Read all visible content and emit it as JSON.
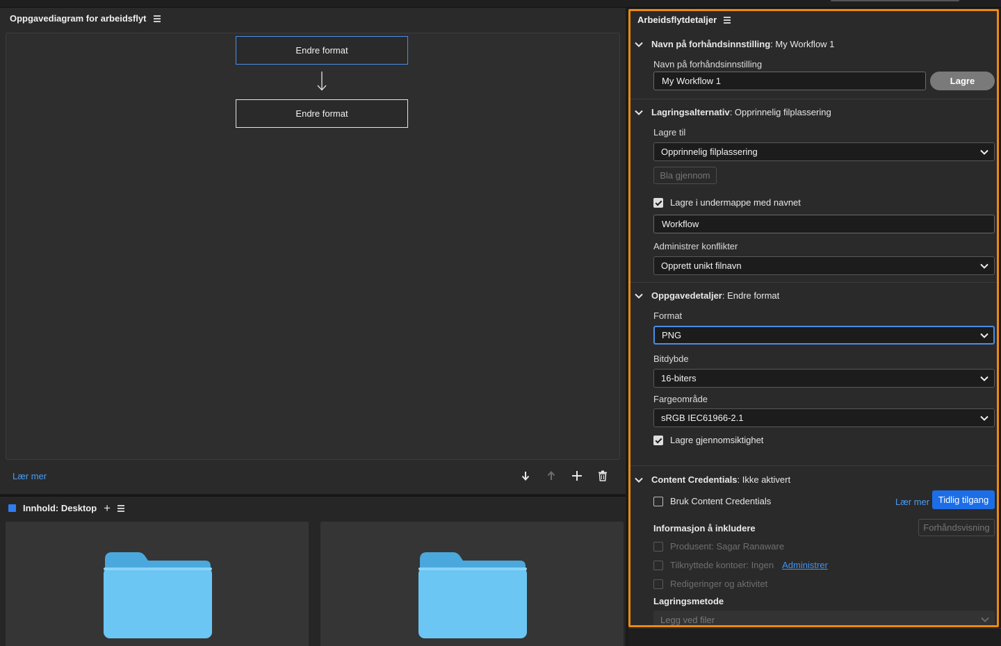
{
  "workflow_diagram": {
    "title": "Oppgavediagram for arbeidsflyt",
    "steps": [
      "Endre format",
      "Endre format"
    ],
    "learn_more": "Lær mer",
    "tools": [
      "move-down",
      "move-up",
      "add",
      "delete"
    ]
  },
  "content": {
    "title": "Innhold: Desktop",
    "tiles": [
      "folder",
      "folder"
    ]
  },
  "details": {
    "title": "Arbeidsflytdetaljer",
    "preset_section": {
      "title": "Navn på forhåndsinnstilling",
      "title_value": ": My Workflow 1",
      "label": "Navn på forhåndsinnstilling",
      "value": "My Workflow 1",
      "save_button": "Lagre"
    },
    "save_section": {
      "title": "Lagringsalternativ",
      "title_value": ": Opprinnelig filplassering",
      "save_to_label": "Lagre til",
      "save_to_value": "Opprinnelig filplassering",
      "browse_button": "Bla gjennom",
      "subfolder_checkbox": "Lagre i undermappe med navnet",
      "subfolder_checked": true,
      "subfolder_value": "Workflow",
      "conflicts_label": "Administrer konflikter",
      "conflicts_value": "Opprett unikt filnavn"
    },
    "task_section": {
      "title": "Oppgavedetaljer",
      "title_value": ": Endre format",
      "format_label": "Format",
      "format_value": "PNG",
      "bitdepth_label": "Bitdybde",
      "bitdepth_value": "16-biters",
      "colorspace_label": "Fargeområde",
      "colorspace_value": "sRGB IEC61966-2.1",
      "transparency_checkbox": "Lagre gjennomsiktighet",
      "transparency_checked": true
    },
    "credentials_section": {
      "title": "Content Credentials",
      "title_value": ": Ikke aktivert",
      "use_checkbox": "Bruk Content Credentials",
      "use_checked": false,
      "learn_more": "Lær mer",
      "early_access_button": "Tidlig tilgang",
      "info_label": "Informasjon å inkludere",
      "preview_button": "Forhåndsvisning",
      "producer": "Produsent: Sagar Ranaware",
      "linked_accounts": "Tilknyttede kontoer: Ingen",
      "manage_link": "Administrer",
      "edits": "Redigeringer og aktivitet",
      "storage_label": "Lagringsmetode",
      "storage_value": "Legg ved filer"
    }
  },
  "colors": {
    "highlight_border": "#f08a0c",
    "accent_blue": "#1c6ee8",
    "link_blue": "#4b9cf2",
    "panel_bg": "#2a2a2a"
  }
}
